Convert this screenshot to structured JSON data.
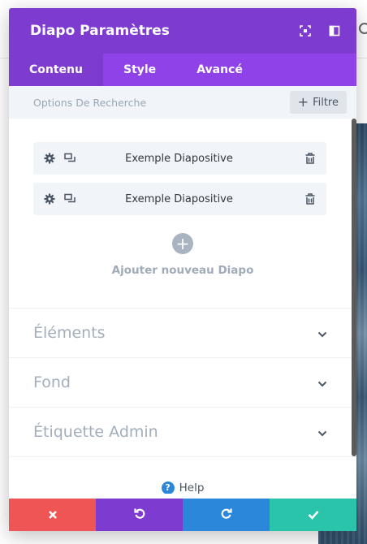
{
  "modal": {
    "title": "Diapo Paramètres",
    "header_icons": [
      "fullscreen-icon",
      "sidebar-layout-icon"
    ]
  },
  "tabs": [
    {
      "label": "Contenu",
      "active": true
    },
    {
      "label": "Style",
      "active": false
    },
    {
      "label": "Avancé",
      "active": false
    }
  ],
  "search": {
    "placeholder": "Options De Recherche",
    "filter_label": "Filtre"
  },
  "slides": [
    {
      "label": "Exemple Diapositive"
    },
    {
      "label": "Exemple Diapositive"
    }
  ],
  "add_item": {
    "label": "Ajouter nouveau Diapo"
  },
  "sections": [
    {
      "title": "Éléments"
    },
    {
      "title": "Fond"
    },
    {
      "title": "Étiquette Admin"
    }
  ],
  "help": {
    "label": "Help"
  },
  "footer": {
    "buttons": [
      {
        "name": "discard",
        "icon": "close-icon",
        "color": "#ef5555"
      },
      {
        "name": "undo",
        "icon": "undo-icon",
        "color": "#7e3bd0"
      },
      {
        "name": "redo",
        "icon": "redo-icon",
        "color": "#2b87da"
      },
      {
        "name": "save",
        "icon": "check-icon",
        "color": "#29c4a9"
      }
    ]
  },
  "colors": {
    "header": "#7e3bd0",
    "tabs": "#8e42e8",
    "panel_bg": "#ffffff",
    "row_bg": "#f1f5f9"
  }
}
